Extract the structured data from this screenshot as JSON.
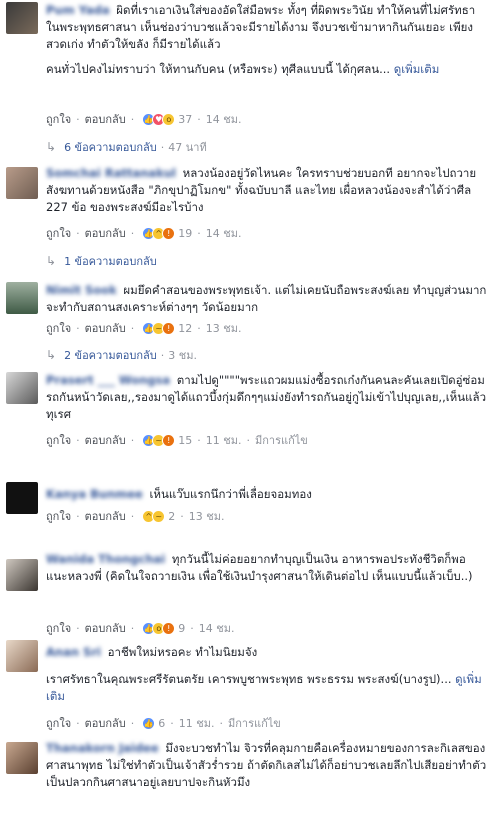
{
  "ui": {
    "like": "ถูกใจ",
    "reply": "ตอบกลับ",
    "edited": "มีการแก้ไข",
    "see_more": "ดูเพิ่มเติม"
  },
  "comments": [
    {
      "name": "Pum Yada",
      "text": "ผิดที่เราเอาเงินใส่ของอัดใส่มือพระ ทั้งๆ ที่ผิดพระวินัย ทำให้คนที่ไม่ศรัทธาในพระพุทธศาสนา เห็นช่องว่าบวชแล้วจะมีรายได้งาม จึงบวชเข้ามาหากินกันเยอะ เพียงสวดเก่ง ทำตัวให้ขลัง ก็มีรายได้แล้ว",
      "text2": "คนทั่วไปคงไม่ทราบว่า ให้ทานกับคน (หรือพระ) ทุศีลแบบนี้ ได้กุศลน...",
      "reactions": [
        "like",
        "love",
        "wow"
      ],
      "count": "37",
      "time": "14 ชม.",
      "replies": "6 ข้อความตอบกลับ",
      "reply_time": "47 นาที"
    },
    {
      "name": "Somchai Rattanakul",
      "text": "หลวงน้องอยู่วัดไหนคะ ใครทราบช่วยบอกที อยากจะไปถวายสังฆทานด้วยหนังสือ \"ภิกขุปาฏิโมกข\" ทั้งฉบับบาลี และไทย เผื่อหลวงน้องจะสำได้ว่าศีล 227 ข้อ ของพระสงฆ์มีอะไรบ้าง",
      "reactions": [
        "like",
        "haha",
        "angry"
      ],
      "count": "19",
      "time": "14 ชม.",
      "replies": "1 ข้อความตอบกลับ",
      "reply_time": ""
    },
    {
      "name": "Nimit Sook",
      "text": "ผมยึดคำสอนของพระพุทธเจ้า. แต่ไม่เคยนับถือพระสงฆ์เลย ทำบุญส่วนมากจะทำกับสถานสงเคราะห์ต่างๆๆ วัดน้อยมาก",
      "reactions": [
        "like",
        "sad",
        "angry"
      ],
      "count": "12",
      "time": "13 ชม.",
      "replies": "2 ข้อความตอบกลับ",
      "reply_time": "3 ชม."
    },
    {
      "name": "Prasert ___ Wongsa",
      "text": "ตามไปดู\"\"\"\"พระแถวผมแม่งซื้อรถเก๋งกันคนละคันเลยเปิดอู่ซ่อมรถกันหน้าวัดเลย,,รองมาดูได้แถวบึ้งกุ่มดึกๆๆแม่งยังทำรถกันอยู่กูไม่เข้าไปบุญเลย,,เห็นแล้วทุเรศ",
      "reactions": [
        "like",
        "sad",
        "angry"
      ],
      "count": "15",
      "time": "11 ชม.",
      "edited": true,
      "replies": "",
      "reply_time": ""
    },
    {
      "name": "Kanya Bunmee",
      "text": "เห็นแว๊บแรกนึกว่าพี่เลื่อยจอมทอง",
      "reactions": [
        "haha",
        "sad"
      ],
      "count": "2",
      "time": "13 ชม.",
      "replies": "",
      "reply_time": ""
    },
    {
      "name": "Wanida Thongchai",
      "text": "ทุกวันนี้ไม่ค่อยอยากทำบุญเป็นเงิน อาหารพอประทังชีวิตก็พอแนะหลวงพี่ (คิดในใจถวายเงิน เพื่อใช้เงินบำรุงศาสนาให้เดินต่อไป เห็นแบบนี้แล้วเบ็บ..)",
      "reactions": [
        "like",
        "wow",
        "angry"
      ],
      "count": "9",
      "time": "14 ชม.",
      "replies": "",
      "reply_time": ""
    },
    {
      "name": "Anan Sri",
      "text": "อาชีพใหม่หรอคะ ทำไมนิยมจัง",
      "text2": "เราศรัทธาในคุณพระศรีรัตนตรัย เคารพบูชาพระพุทธ พระธรรม พระสงฆ์(บางรูป)...",
      "reactions": [
        "like"
      ],
      "count": "6",
      "time": "11 ชม.",
      "edited": true,
      "replies": "",
      "reply_time": ""
    },
    {
      "name": "Thanakorn Jaidee",
      "text": "มึงจะบวชทำไม จิวรที่คลุมกายคือเครื่องหมายของการละกิเลสของศาสนาพุทธ ไม่ใช่ทำตัวเป็นเจ้าสัวร่ำรวย ถ้าตัดกิเลสไม่ได้ก็อย่าบวชเลยลึกไปเสียอย่าทำตัวเป็นปลวกกินศาสนาอยู่เลยบาปจะกินหัวมึง",
      "reactions": [],
      "count": "",
      "time": "",
      "replies": "",
      "reply_time": ""
    }
  ]
}
